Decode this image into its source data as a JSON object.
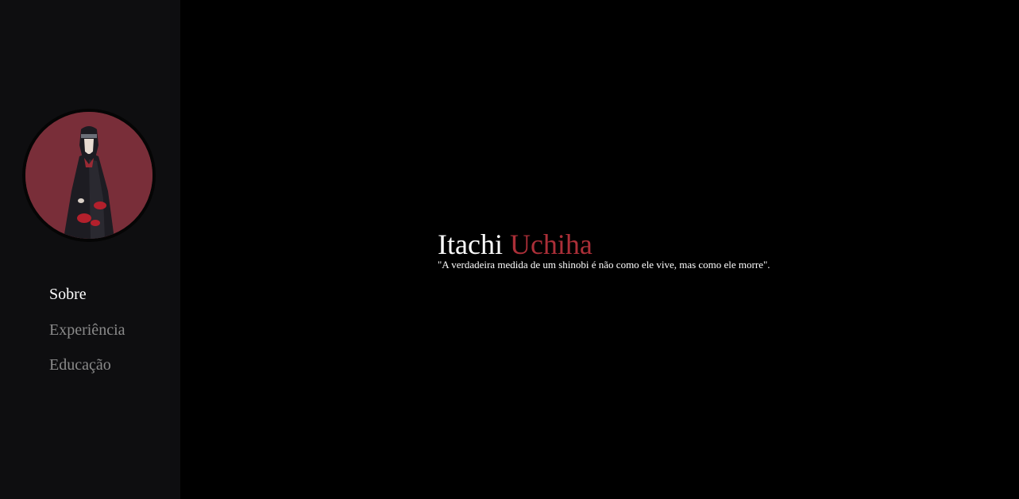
{
  "profile": {
    "first_name": "Itachi",
    "last_name": "Uchiha",
    "quote": "\"A verdadeira medida de um shinobi é não como ele vive, mas como ele morre\".",
    "avatar_icon": "itachi-portrait-icon"
  },
  "nav": {
    "items": [
      {
        "label": "Sobre",
        "active": true
      },
      {
        "label": "Experiência",
        "active": false
      },
      {
        "label": "Educação",
        "active": false
      }
    ]
  },
  "colors": {
    "page_background": "#000000",
    "sidebar_background": "#0e0e10",
    "accent": "#ab2f38",
    "avatar_background": "#792e39",
    "nav_active": "#ffffff",
    "nav_inactive": "#8a8a8a"
  }
}
